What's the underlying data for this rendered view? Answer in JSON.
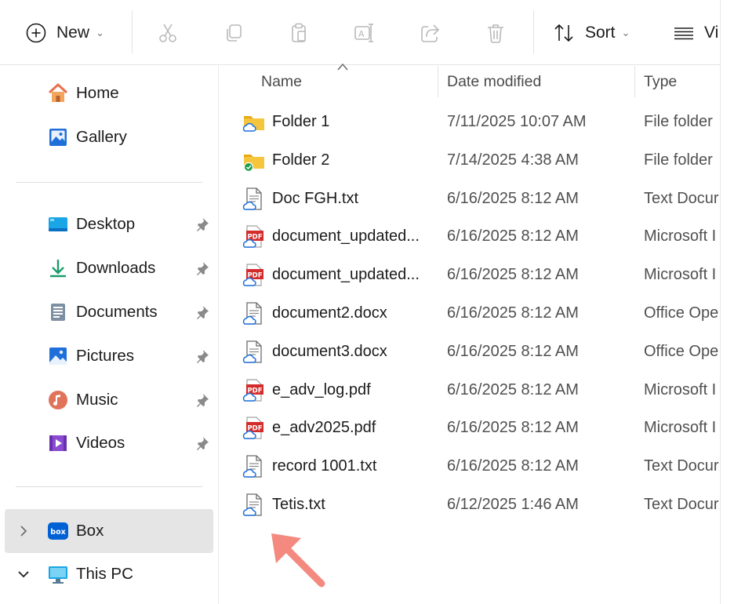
{
  "toolbar": {
    "new_label": "New",
    "sort_label": "Sort",
    "view_label": "Vi"
  },
  "sidebar": {
    "quick": [
      {
        "label": "Home",
        "icon": "home-icon"
      },
      {
        "label": "Gallery",
        "icon": "gallery-icon"
      }
    ],
    "pinned": [
      {
        "label": "Desktop",
        "icon": "desktop-icon"
      },
      {
        "label": "Downloads",
        "icon": "downloads-icon"
      },
      {
        "label": "Documents",
        "icon": "documents-icon"
      },
      {
        "label": "Pictures",
        "icon": "pictures-icon"
      },
      {
        "label": "Music",
        "icon": "music-icon"
      },
      {
        "label": "Videos",
        "icon": "videos-icon"
      }
    ],
    "drives": [
      {
        "label": "Box",
        "icon": "box-icon",
        "selected": true,
        "expanded": false
      },
      {
        "label": "This PC",
        "icon": "this-pc-icon",
        "selected": false,
        "expanded": true
      }
    ],
    "box_badge_text": "box"
  },
  "columns": {
    "name": "Name",
    "date": "Date modified",
    "type": "Type"
  },
  "files": [
    {
      "name": "Folder 1",
      "date": "7/11/2025 10:07 AM",
      "type": "File folder",
      "kind": "folder",
      "status": "cloud"
    },
    {
      "name": "Folder 2",
      "date": "7/14/2025 4:38 AM",
      "type": "File folder",
      "kind": "folder",
      "status": "synced"
    },
    {
      "name": "Doc FGH.txt",
      "date": "6/16/2025 8:12 AM",
      "type": "Text Docur",
      "kind": "txt",
      "status": "cloud"
    },
    {
      "name": "document_updated...",
      "date": "6/16/2025 8:12 AM",
      "type": "Microsoft I",
      "kind": "pdf",
      "status": "cloud"
    },
    {
      "name": "document_updated...",
      "date": "6/16/2025 8:12 AM",
      "type": "Microsoft I",
      "kind": "pdf",
      "status": "cloud"
    },
    {
      "name": "document2.docx",
      "date": "6/16/2025 8:12 AM",
      "type": "Office Ope",
      "kind": "txt",
      "status": "cloud"
    },
    {
      "name": "document3.docx",
      "date": "6/16/2025 8:12 AM",
      "type": "Office Ope",
      "kind": "txt",
      "status": "cloud"
    },
    {
      "name": "e_adv_log.pdf",
      "date": "6/16/2025 8:12 AM",
      "type": "Microsoft I",
      "kind": "pdf",
      "status": "cloud"
    },
    {
      "name": "e_adv2025.pdf",
      "date": "6/16/2025 8:12 AM",
      "type": "Microsoft I",
      "kind": "pdf",
      "status": "cloud"
    },
    {
      "name": "record 1001.txt",
      "date": "6/16/2025 8:12 AM",
      "type": "Text Docur",
      "kind": "txt",
      "status": "cloud"
    },
    {
      "name": "Tetis.txt",
      "date": "6/12/2025 1:46 AM",
      "type": "Text Docur",
      "kind": "txt",
      "status": "cloud"
    }
  ],
  "colors": {
    "accent": "#0f6cbd",
    "pdf_red": "#d42b2b",
    "folder_yellow": "#f4c53d",
    "arrow": "#f4897f"
  }
}
